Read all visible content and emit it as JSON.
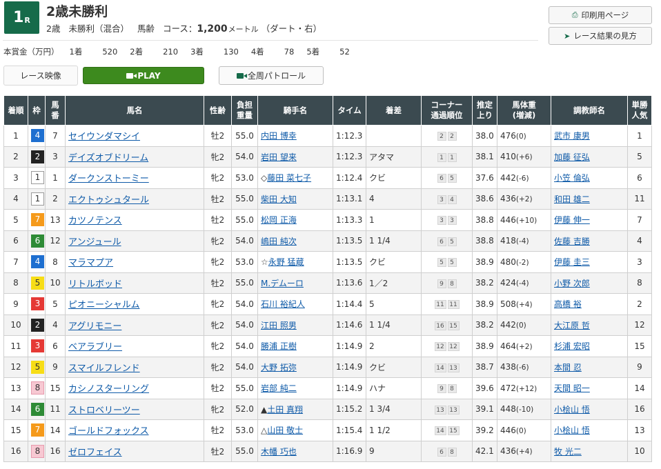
{
  "race": {
    "number": "1",
    "number_suffix": "R",
    "title": "2歳未勝利",
    "age": "2歳",
    "class_label": "未勝利（混合）",
    "weight_rule": "馬齢",
    "course_label": "コース：",
    "distance": "1,200",
    "distance_unit": "メートル",
    "course_condition": "（ダート・右）"
  },
  "side_buttons": {
    "print_label": "印刷用ページ",
    "guide_label": "レース結果の見方"
  },
  "prize": {
    "label": "本賞金（万円）",
    "items": [
      {
        "place": "1着",
        "value": "520"
      },
      {
        "place": "2着",
        "value": "210"
      },
      {
        "place": "3着",
        "value": "130"
      },
      {
        "place": "4着",
        "value": "78"
      },
      {
        "place": "5着",
        "value": "52"
      }
    ]
  },
  "video": {
    "label": "レース映像",
    "play_label": "PLAY",
    "patrol_label": "全周パトロール"
  },
  "columns": [
    {
      "key": "rank",
      "label": "着順"
    },
    {
      "key": "waku",
      "label": "枠"
    },
    {
      "key": "num",
      "label": "馬\n番"
    },
    {
      "key": "horse",
      "label": "馬名"
    },
    {
      "key": "sexage",
      "label": "性齢"
    },
    {
      "key": "weight",
      "label": "負担\n重量"
    },
    {
      "key": "jockey",
      "label": "騎手名"
    },
    {
      "key": "time",
      "label": "タイム"
    },
    {
      "key": "margin",
      "label": "着差"
    },
    {
      "key": "corner",
      "label": "コーナー\n通過順位"
    },
    {
      "key": "last",
      "label": "推定\n上り"
    },
    {
      "key": "body",
      "label": "馬体重\n(増減)"
    },
    {
      "key": "trainer",
      "label": "調教師名"
    },
    {
      "key": "pop",
      "label": "単勝\n人気"
    }
  ],
  "waku_colors": {
    "1": {
      "bg": "#ffffff",
      "fg": "#333333"
    },
    "2": {
      "bg": "#222222",
      "fg": "#ffffff"
    },
    "3": {
      "bg": "#e53935",
      "fg": "#ffffff"
    },
    "4": {
      "bg": "#1e6fd0",
      "fg": "#ffffff"
    },
    "5": {
      "bg": "#f7dd16",
      "fg": "#333333"
    },
    "6": {
      "bg": "#2e8b36",
      "fg": "#ffffff"
    },
    "7": {
      "bg": "#f59a1b",
      "fg": "#ffffff"
    },
    "8": {
      "bg": "#f7c8d2",
      "fg": "#333333"
    }
  },
  "rows": [
    {
      "rank": "1",
      "waku": "4",
      "num": "7",
      "horse": "セイウンダマシイ",
      "sexage": "牡2",
      "weight": "55.0",
      "jockey": "内田 博幸",
      "time": "1:12.3",
      "margin": "",
      "corner": [
        "2",
        "2"
      ],
      "last": "38.0",
      "body": "476",
      "body_diff": "(0)",
      "trainer": "武市 康男",
      "pop": "1"
    },
    {
      "rank": "2",
      "waku": "2",
      "num": "3",
      "horse": "デイズオブドリーム",
      "sexage": "牝2",
      "weight": "54.0",
      "jockey": "岩田 望来",
      "time": "1:12.3",
      "margin": "アタマ",
      "corner": [
        "1",
        "1"
      ],
      "last": "38.1",
      "body": "410",
      "body_diff": "(+6)",
      "trainer": "加藤 征弘",
      "pop": "5"
    },
    {
      "rank": "3",
      "waku": "1",
      "num": "1",
      "horse": "ダークンストーミー",
      "sexage": "牝2",
      "weight": "53.0",
      "jockey": "◇藤田 菜七子",
      "time": "1:12.4",
      "margin": "クビ",
      "corner": [
        "6",
        "5"
      ],
      "last": "37.6",
      "body": "442",
      "body_diff": "(-6)",
      "trainer": "小笠 倫弘",
      "pop": "6"
    },
    {
      "rank": "4",
      "waku": "1",
      "num": "2",
      "horse": "エクトゥシュタール",
      "sexage": "牡2",
      "weight": "55.0",
      "jockey": "柴田 大知",
      "time": "1:13.1",
      "margin": "4",
      "corner": [
        "3",
        "4"
      ],
      "last": "38.6",
      "body": "436",
      "body_diff": "(+2)",
      "trainer": "和田 雄二",
      "pop": "11"
    },
    {
      "rank": "5",
      "waku": "7",
      "num": "13",
      "horse": "カツノテンス",
      "sexage": "牡2",
      "weight": "55.0",
      "jockey": "松岡 正海",
      "time": "1:13.3",
      "margin": "1",
      "corner": [
        "3",
        "3"
      ],
      "last": "38.8",
      "body": "446",
      "body_diff": "(+10)",
      "trainer": "伊藤 伸一",
      "pop": "7"
    },
    {
      "rank": "6",
      "waku": "6",
      "num": "12",
      "horse": "アンジュール",
      "sexage": "牝2",
      "weight": "54.0",
      "jockey": "嶋田 純次",
      "time": "1:13.5",
      "margin": "1 1/4",
      "corner": [
        "6",
        "5"
      ],
      "last": "38.8",
      "body": "418",
      "body_diff": "(-4)",
      "trainer": "佐藤 吉勝",
      "pop": "4"
    },
    {
      "rank": "7",
      "waku": "4",
      "num": "8",
      "horse": "マラマプア",
      "sexage": "牝2",
      "weight": "53.0",
      "jockey": "☆永野 猛蔵",
      "time": "1:13.5",
      "margin": "クビ",
      "corner": [
        "5",
        "5"
      ],
      "last": "38.9",
      "body": "480",
      "body_diff": "(-2)",
      "trainer": "伊藤 圭三",
      "pop": "3"
    },
    {
      "rank": "8",
      "waku": "5",
      "num": "10",
      "horse": "リトルボッド",
      "sexage": "牡2",
      "weight": "55.0",
      "jockey": "M.デムーロ",
      "time": "1:13.6",
      "margin": "1／2",
      "corner": [
        "9",
        "8"
      ],
      "last": "38.2",
      "body": "424",
      "body_diff": "(-4)",
      "trainer": "小野 次郎",
      "pop": "8"
    },
    {
      "rank": "9",
      "waku": "3",
      "num": "5",
      "horse": "ピオニーシャルム",
      "sexage": "牝2",
      "weight": "54.0",
      "jockey": "石川 裕紀人",
      "time": "1:14.4",
      "margin": "5",
      "corner": [
        "11",
        "11"
      ],
      "last": "38.9",
      "body": "508",
      "body_diff": "(+4)",
      "trainer": "高橋 裕",
      "pop": "2"
    },
    {
      "rank": "10",
      "waku": "2",
      "num": "4",
      "horse": "アグリモニー",
      "sexage": "牝2",
      "weight": "54.0",
      "jockey": "江田 照男",
      "time": "1:14.6",
      "margin": "1 1/4",
      "corner": [
        "16",
        "15"
      ],
      "last": "38.2",
      "body": "442",
      "body_diff": "(0)",
      "trainer": "大江原 哲",
      "pop": "12"
    },
    {
      "rank": "11",
      "waku": "3",
      "num": "6",
      "horse": "ベアラブリー",
      "sexage": "牝2",
      "weight": "54.0",
      "jockey": "勝浦 正樹",
      "time": "1:14.9",
      "margin": "2",
      "corner": [
        "12",
        "12"
      ],
      "last": "38.9",
      "body": "464",
      "body_diff": "(+2)",
      "trainer": "杉浦 宏昭",
      "pop": "15"
    },
    {
      "rank": "12",
      "waku": "5",
      "num": "9",
      "horse": "スマイルフレンド",
      "sexage": "牝2",
      "weight": "54.0",
      "jockey": "大野 拓弥",
      "time": "1:14.9",
      "margin": "クビ",
      "corner": [
        "14",
        "13"
      ],
      "last": "38.7",
      "body": "438",
      "body_diff": "(-6)",
      "trainer": "本間 忍",
      "pop": "9"
    },
    {
      "rank": "13",
      "waku": "8",
      "num": "15",
      "horse": "カシノスターリング",
      "sexage": "牡2",
      "weight": "55.0",
      "jockey": "岩部 純二",
      "time": "1:14.9",
      "margin": "ハナ",
      "corner": [
        "9",
        "8"
      ],
      "last": "39.6",
      "body": "472",
      "body_diff": "(+12)",
      "trainer": "天間 昭一",
      "pop": "14"
    },
    {
      "rank": "14",
      "waku": "6",
      "num": "11",
      "horse": "ストロベリーツー",
      "sexage": "牝2",
      "weight": "52.0",
      "jockey": "▲土田 真翔",
      "time": "1:15.2",
      "margin": "1 3/4",
      "corner": [
        "13",
        "13"
      ],
      "last": "39.1",
      "body": "448",
      "body_diff": "(-10)",
      "trainer": "小桧山 悟",
      "pop": "16"
    },
    {
      "rank": "15",
      "waku": "7",
      "num": "14",
      "horse": "ゴールドフォックス",
      "sexage": "牡2",
      "weight": "53.0",
      "jockey": "△山田 敬士",
      "time": "1:15.4",
      "margin": "1 1/2",
      "corner": [
        "14",
        "15"
      ],
      "last": "39.2",
      "body": "446",
      "body_diff": "(0)",
      "trainer": "小桧山 悟",
      "pop": "13"
    },
    {
      "rank": "16",
      "waku": "8",
      "num": "16",
      "horse": "ゼロフェイス",
      "sexage": "牡2",
      "weight": "55.0",
      "jockey": "木幡 巧也",
      "time": "1:16.9",
      "margin": "9",
      "corner": [
        "6",
        "8"
      ],
      "last": "42.1",
      "body": "436",
      "body_diff": "(+4)",
      "trainer": "牧 光二",
      "pop": "10"
    }
  ]
}
